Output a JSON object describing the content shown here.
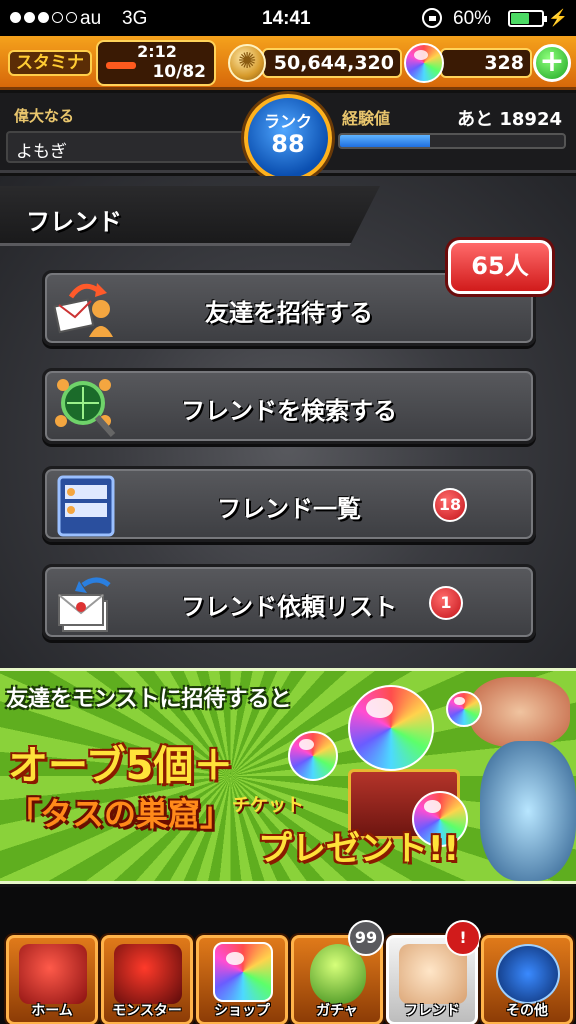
{
  "status_bar": {
    "carrier": "au",
    "network": "3G",
    "time": "14:41",
    "battery_percent": "60%",
    "battery_level": 0.6
  },
  "header": {
    "stamina_label": "スタミナ",
    "stamina_timer": "2:12",
    "stamina_count": "10/82",
    "gold": "50,644,320",
    "orbs": "328",
    "plus_label": "+"
  },
  "player": {
    "title": "偉大なる",
    "name": "よもぎ",
    "rank_label": "ランク",
    "rank": "88",
    "exp_label": "経験値",
    "exp_remaining": "あと 18924",
    "exp_progress": 0.4
  },
  "friends": {
    "section_title": "フレンド",
    "friend_count": "65人",
    "menu": [
      {
        "label": "友達を招待する",
        "icon": "invite-icon"
      },
      {
        "label": "フレンドを検索する",
        "icon": "search-icon"
      },
      {
        "label": "フレンド一覧",
        "icon": "list-icon",
        "badge": "18"
      },
      {
        "label": "フレンド依頼リスト",
        "icon": "request-icon",
        "badge": "1"
      }
    ]
  },
  "banner": {
    "line1": "友達をモンストに招待すると",
    "line2": "オーブ5個＋",
    "line3": "「タスの巣窟」",
    "line3b": "チケット",
    "line4": "プレゼント!!"
  },
  "bottom_nav": [
    {
      "label": "ホーム",
      "icon": "home-icon"
    },
    {
      "label": "モンスター",
      "icon": "monster-icon"
    },
    {
      "label": "ショップ",
      "icon": "shop-icon"
    },
    {
      "label": "ガチャ",
      "icon": "gacha-icon",
      "badge": "99"
    },
    {
      "label": "フレンド",
      "icon": "friend-icon",
      "badge": "!"
    },
    {
      "label": "その他",
      "icon": "other-icon"
    }
  ],
  "colors": {
    "header_orange": "#f5a21c",
    "badge_red": "#d11b1b",
    "exp_blue": "#1f6fe0",
    "banner_green": "#8ad23a"
  }
}
